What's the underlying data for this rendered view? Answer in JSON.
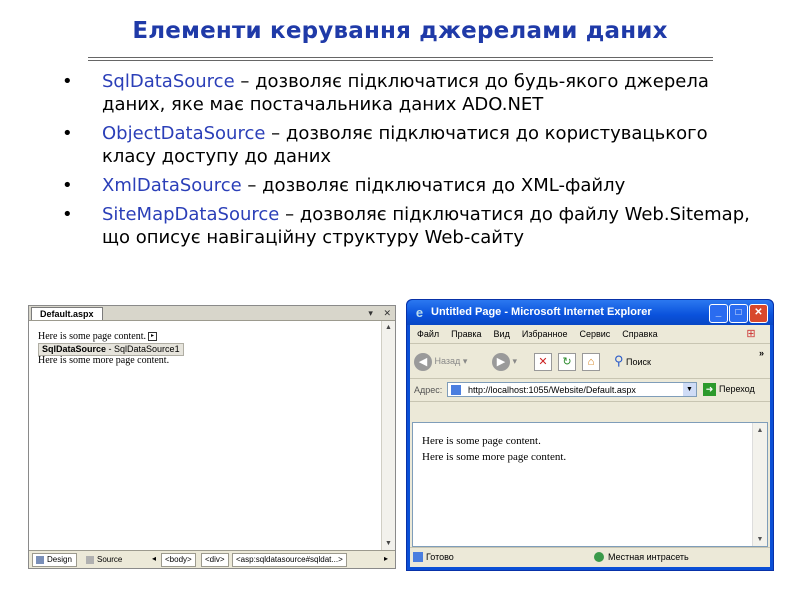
{
  "slide": {
    "title": "Елементи керування джерелами даних",
    "bullets": [
      {
        "name": "SqlDataSource",
        "text": " – дозволяє підключатися до будь-якого джерела даних, яке має постачальника даних ADO.NET"
      },
      {
        "name": "ObjectDataSource",
        "text": " – дозволяє підключатися до користувацького класу доступу до даних"
      },
      {
        "name": "XmlDataSource",
        "text": " – дозволяє підключатися до XML-файлу"
      },
      {
        "name": "SiteMapDataSource",
        "text": " – дозволяє підключатися до файлу Web.Sitemap, що описує навігаційну структуру Web-сайту"
      }
    ],
    "bullet_glyph": "•"
  },
  "vs": {
    "tab": "Default.aspx",
    "tab_dropdown": "▾",
    "tab_close": "✕",
    "line1": "Here is some page content.",
    "control_bold": "SqlDataSource",
    "control_rest": " - SqlDataSource1",
    "line2": "Here is some more page content.",
    "bottom_tabs": [
      "Design",
      "Source"
    ],
    "crumbs": [
      "<body>",
      "<div>",
      "<asp:sqldatasource#sqldat...>"
    ],
    "nav_left": "◂",
    "nav_right": "▸"
  },
  "ie": {
    "title": "Untitled Page - Microsoft Internet Explorer",
    "menu": [
      "Файл",
      "Правка",
      "Вид",
      "Избранное",
      "Сервис",
      "Справка"
    ],
    "back": "Назад",
    "search": "Поиск",
    "address_label": "Адрес:",
    "url": "http://localhost:1055/Website/Default.aspx",
    "go": "Переход",
    "content_lines": [
      "Here is some page content.",
      "Here is some more page content."
    ],
    "status_left": "Готово",
    "status_zone": "Местная интрасеть",
    "more": "»"
  },
  "colors": {
    "title": "#1f3aa8",
    "keyword": "#2b3fb8",
    "xp_blue": "#0a52dc"
  }
}
